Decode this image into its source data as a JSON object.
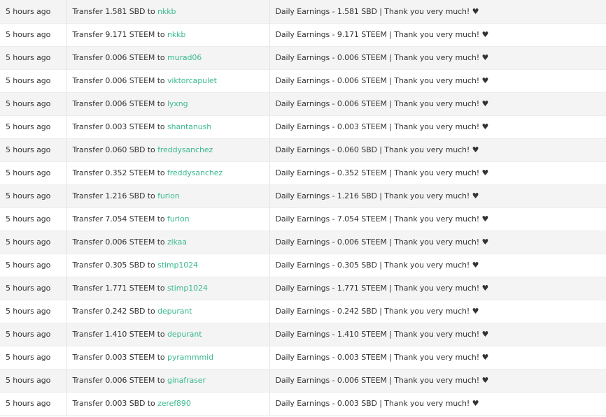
{
  "transfers": [
    {
      "time": "5 hours ago",
      "prefix": "Transfer 1.581 SBD to ",
      "to": "nkkb",
      "memo": "Daily Earnings - 1.581 SBD | Thank you very much! ♥"
    },
    {
      "time": "5 hours ago",
      "prefix": "Transfer 9.171 STEEM to ",
      "to": "nkkb",
      "memo": "Daily Earnings - 9.171 STEEM | Thank you very much! ♥"
    },
    {
      "time": "5 hours ago",
      "prefix": "Transfer 0.006 STEEM to ",
      "to": "murad06",
      "memo": "Daily Earnings - 0.006 STEEM | Thank you very much! ♥"
    },
    {
      "time": "5 hours ago",
      "prefix": "Transfer 0.006 STEEM to ",
      "to": "viktorcapulet",
      "memo": "Daily Earnings - 0.006 STEEM | Thank you very much! ♥"
    },
    {
      "time": "5 hours ago",
      "prefix": "Transfer 0.006 STEEM to ",
      "to": "lyxng",
      "memo": "Daily Earnings - 0.006 STEEM | Thank you very much! ♥"
    },
    {
      "time": "5 hours ago",
      "prefix": "Transfer 0.003 STEEM to ",
      "to": "shantanush",
      "memo": "Daily Earnings - 0.003 STEEM | Thank you very much! ♥"
    },
    {
      "time": "5 hours ago",
      "prefix": "Transfer 0.060 SBD to ",
      "to": "freddysanchez",
      "memo": "Daily Earnings - 0.060 SBD | Thank you very much! ♥"
    },
    {
      "time": "5 hours ago",
      "prefix": "Transfer 0.352 STEEM to ",
      "to": "freddysanchez",
      "memo": "Daily Earnings - 0.352 STEEM | Thank you very much! ♥"
    },
    {
      "time": "5 hours ago",
      "prefix": "Transfer 1.216 SBD to ",
      "to": "furion",
      "memo": "Daily Earnings - 1.216 SBD | Thank you very much! ♥"
    },
    {
      "time": "5 hours ago",
      "prefix": "Transfer 7.054 STEEM to ",
      "to": "furion",
      "memo": "Daily Earnings - 7.054 STEEM | Thank you very much! ♥"
    },
    {
      "time": "5 hours ago",
      "prefix": "Transfer 0.006 STEEM to ",
      "to": "zikaa",
      "memo": "Daily Earnings - 0.006 STEEM | Thank you very much! ♥"
    },
    {
      "time": "5 hours ago",
      "prefix": "Transfer 0.305 SBD to ",
      "to": "stimp1024",
      "memo": "Daily Earnings - 0.305 SBD | Thank you very much! ♥"
    },
    {
      "time": "5 hours ago",
      "prefix": "Transfer 1.771 STEEM to ",
      "to": "stimp1024",
      "memo": "Daily Earnings - 1.771 STEEM | Thank you very much! ♥"
    },
    {
      "time": "5 hours ago",
      "prefix": "Transfer 0.242 SBD to ",
      "to": "depurant",
      "memo": "Daily Earnings - 0.242 SBD | Thank you very much! ♥"
    },
    {
      "time": "5 hours ago",
      "prefix": "Transfer 1.410 STEEM to ",
      "to": "depurant",
      "memo": "Daily Earnings - 1.410 STEEM | Thank you very much! ♥"
    },
    {
      "time": "5 hours ago",
      "prefix": "Transfer 0.003 STEEM to ",
      "to": "pyrammmid",
      "memo": "Daily Earnings - 0.003 STEEM | Thank you very much! ♥"
    },
    {
      "time": "5 hours ago",
      "prefix": "Transfer 0.006 STEEM to ",
      "to": "ginafraser",
      "memo": "Daily Earnings - 0.006 STEEM | Thank you very much! ♥"
    },
    {
      "time": "5 hours ago",
      "prefix": "Transfer 0.003 SBD to ",
      "to": "zeref890",
      "memo": "Daily Earnings - 0.003 SBD | Thank you very much! ♥"
    }
  ],
  "colors": {
    "link": "#3ab990",
    "row_stripe": "#f4f4f4",
    "text": "#333333"
  }
}
